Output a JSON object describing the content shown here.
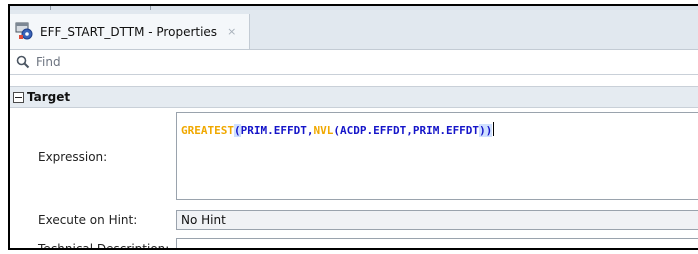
{
  "window": {
    "tab_title": "EFF_START_DTTM - Properties",
    "tab_close": "×"
  },
  "search": {
    "placeholder": "Find"
  },
  "section": {
    "title": "Target"
  },
  "fields": {
    "expression_label": "Expression:",
    "expression_tokens": [
      {
        "text": "GREATEST",
        "kind": "fn"
      },
      {
        "text": "(",
        "kind": "punct"
      },
      {
        "text": "PRIM.EFFDT",
        "kind": "id"
      },
      {
        "text": ",",
        "kind": "punct"
      },
      {
        "text": "NVL",
        "kind": "fn"
      },
      {
        "text": "(",
        "kind": "punct"
      },
      {
        "text": "ACDP.EFFDT",
        "kind": "id"
      },
      {
        "text": ",",
        "kind": "punct"
      },
      {
        "text": "PRIM.EFFDT",
        "kind": "id"
      },
      {
        "text": "))",
        "kind": "punct"
      }
    ],
    "execute_on_hint_label": "Execute on Hint:",
    "execute_on_hint_value": "No Hint",
    "technical_description_label": "Technical Description:"
  },
  "colors": {
    "function_token": "#f0a800",
    "identifier_token": "#1515c9",
    "bracket_highlight": "#cfe0ff"
  },
  "icons": {
    "tab": "properties-icon",
    "search": "magnifier-icon",
    "section_toggle": "collapse-minus-icon"
  }
}
